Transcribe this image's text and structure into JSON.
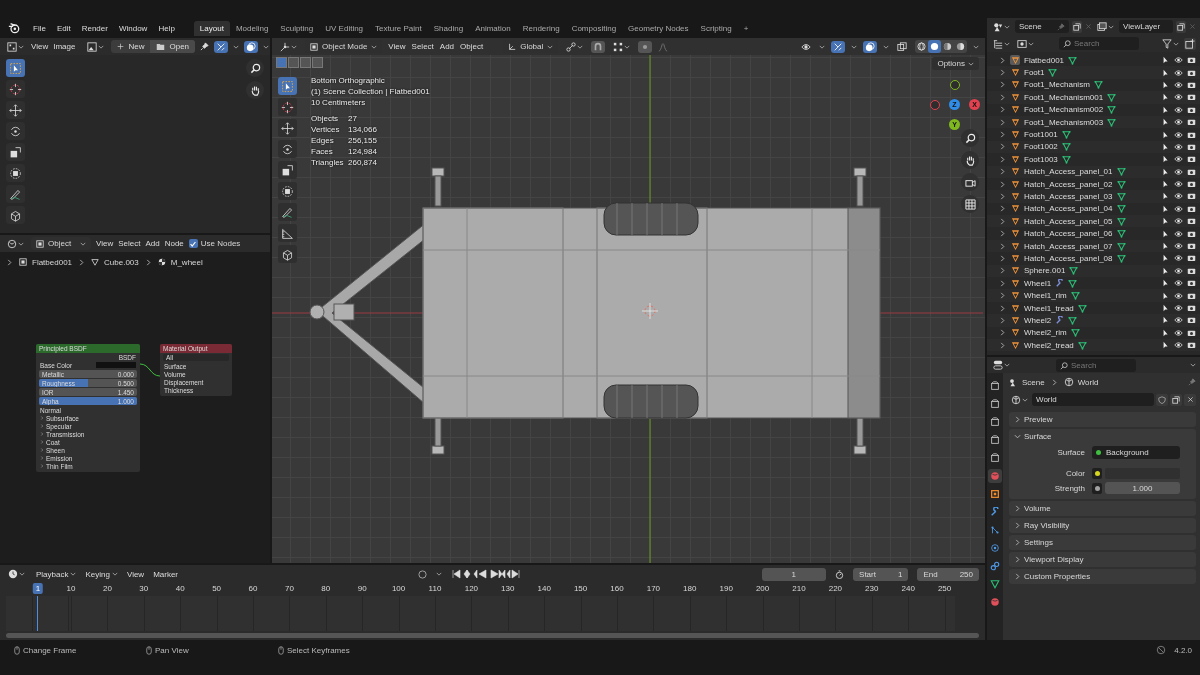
{
  "top_bar": {
    "menus": [
      "File",
      "Edit",
      "Render",
      "Window",
      "Help"
    ],
    "workspaces": [
      {
        "label": "Layout",
        "selected": true
      },
      {
        "label": "Modeling",
        "selected": false
      },
      {
        "label": "Sculpting",
        "selected": false
      },
      {
        "label": "UV Editing",
        "selected": false
      },
      {
        "label": "Texture Paint",
        "selected": false
      },
      {
        "label": "Shading",
        "selected": false
      },
      {
        "label": "Animation",
        "selected": false
      },
      {
        "label": "Rendering",
        "selected": false
      },
      {
        "label": "Compositing",
        "selected": false
      },
      {
        "label": "Geometry Nodes",
        "selected": false
      },
      {
        "label": "Scripting",
        "selected": false
      }
    ],
    "add_workspace": "+"
  },
  "image_editor": {
    "menus": [
      "View",
      "Image"
    ],
    "new_button": "New",
    "open_button": "Open",
    "tools": [
      {
        "kind": "select",
        "selected": true
      },
      {
        "kind": "cursor",
        "selected": false
      },
      {
        "kind": "move",
        "selected": false
      },
      {
        "kind": "rotate",
        "selected": false
      },
      {
        "kind": "scale",
        "selected": false
      },
      {
        "kind": "transform",
        "selected": false
      },
      {
        "kind": "annotate",
        "selected": false
      },
      {
        "kind": "add_cube",
        "selected": false
      }
    ]
  },
  "node_editor": {
    "mode": "Object",
    "menus": [
      "View",
      "Select",
      "Add",
      "Node"
    ],
    "use_nodes": {
      "label": "Use Nodes",
      "checked": true
    },
    "breadcrumbs": [
      {
        "kind": "object",
        "label": "Flatbed001"
      },
      {
        "kind": "mesh",
        "label": "Cube.003"
      },
      {
        "kind": "material",
        "label": "M_wheel"
      }
    ],
    "nodes": [
      {
        "kind": "shader",
        "title": "Principled BSDF",
        "output": "BSDF",
        "rows": [
          {
            "kind": "color",
            "label": "Base Color"
          },
          {
            "kind": "slider",
            "label": "Metallic",
            "value": "0.000",
            "level": 0
          },
          {
            "kind": "slider",
            "label": "Roughness",
            "value": "0.500",
            "level": 0.5
          },
          {
            "kind": "slider",
            "label": "IOR",
            "value": "1.450",
            "level": 0
          },
          {
            "kind": "slider",
            "label": "Alpha",
            "value": "1.000",
            "level": 1
          },
          {
            "kind": "socket",
            "label": "Normal"
          },
          {
            "kind": "group",
            "label": "Subsurface"
          },
          {
            "kind": "group",
            "label": "Specular"
          },
          {
            "kind": "group",
            "label": "Transmission"
          },
          {
            "kind": "group",
            "label": "Coat"
          },
          {
            "kind": "group",
            "label": "Sheen"
          },
          {
            "kind": "group",
            "label": "Emission"
          },
          {
            "kind": "group",
            "label": "Thin Film"
          }
        ]
      },
      {
        "kind": "output",
        "title": "Material Output",
        "target": "All",
        "rows": [
          {
            "kind": "socket",
            "label": "Surface"
          },
          {
            "kind": "socket",
            "label": "Volume"
          },
          {
            "kind": "socket",
            "label": "Displacement"
          },
          {
            "kind": "socket",
            "label": "Thickness"
          }
        ]
      }
    ]
  },
  "viewport": {
    "mode": "Object Mode",
    "menus": [
      "View",
      "Select",
      "Add",
      "Object"
    ],
    "orientation": "Global",
    "options": "Options",
    "toggles": [
      {
        "kind": "visibility",
        "on": false
      },
      {
        "kind": "gizmo",
        "on": true
      },
      {
        "kind": "overlay",
        "on": true
      },
      {
        "kind": "xray",
        "on": false
      }
    ],
    "shading": [
      {
        "kind": "wireframe",
        "selected": false
      },
      {
        "kind": "solid",
        "selected": true
      },
      {
        "kind": "material",
        "selected": false
      },
      {
        "kind": "rendered",
        "selected": false
      }
    ],
    "info": [
      "Bottom Orthographic",
      "(1) Scene Collection | Flatbed001",
      "10 Centimeters"
    ],
    "stats": [
      {
        "label": "Objects",
        "value": "27"
      },
      {
        "label": "Vertices",
        "value": "134,066"
      },
      {
        "label": "Edges",
        "value": "256,155"
      },
      {
        "label": "Faces",
        "value": "124,984"
      },
      {
        "label": "Triangles",
        "value": "260,874"
      }
    ],
    "tools": [
      {
        "kind": "select",
        "selected": true
      },
      {
        "kind": "cursor",
        "selected": false
      },
      {
        "kind": "move",
        "selected": false
      },
      {
        "kind": "rotate",
        "selected": false
      },
      {
        "kind": "scale",
        "selected": false
      },
      {
        "kind": "transform",
        "selected": false
      },
      {
        "kind": "annotate",
        "selected": false
      },
      {
        "kind": "measure",
        "selected": false
      },
      {
        "kind": "add_cube",
        "selected": false
      }
    ],
    "gizmo": [
      {
        "label": "Z",
        "color": "#2f8de8"
      },
      {
        "label": "X",
        "color": "#e2414f"
      },
      {
        "label": "Y",
        "color": "#7fb81e"
      }
    ]
  },
  "timeline": {
    "menus": [
      "Playback",
      "Keying",
      "View",
      "Marker"
    ],
    "current_frame": "1",
    "start_label": "Start",
    "start": "1",
    "end_label": "End",
    "end": "250",
    "ticks": [
      "1",
      "10",
      "20",
      "30",
      "40",
      "50",
      "60",
      "70",
      "80",
      "90",
      "100",
      "110",
      "120",
      "130",
      "140",
      "150",
      "160",
      "170",
      "180",
      "190",
      "200",
      "210",
      "220",
      "230",
      "240",
      "250"
    ]
  },
  "outliner": {
    "scene": "Scene",
    "view_layer": "ViewLayer",
    "search_placeholder": "Search",
    "items": [
      {
        "name": "Flatbed001",
        "active": true,
        "modifier": false
      },
      {
        "name": "Foot1",
        "active": false,
        "modifier": false
      },
      {
        "name": "Foot1_Mechanism",
        "active": false,
        "modifier": false
      },
      {
        "name": "Foot1_Mechanism001",
        "active": false,
        "modifier": false
      },
      {
        "name": "Foot1_Mechanism002",
        "active": false,
        "modifier": false
      },
      {
        "name": "Foot1_Mechanism003",
        "active": false,
        "modifier": false
      },
      {
        "name": "Foot1001",
        "active": false,
        "modifier": false
      },
      {
        "name": "Foot1002",
        "active": false,
        "modifier": false
      },
      {
        "name": "Foot1003",
        "active": false,
        "modifier": false
      },
      {
        "name": "Hatch_Access_panel_01",
        "active": false,
        "modifier": false
      },
      {
        "name": "Hatch_Access_panel_02",
        "active": false,
        "modifier": false
      },
      {
        "name": "Hatch_Access_panel_03",
        "active": false,
        "modifier": false
      },
      {
        "name": "Hatch_Access_panel_04",
        "active": false,
        "modifier": false
      },
      {
        "name": "Hatch_Access_panel_05",
        "active": false,
        "modifier": false
      },
      {
        "name": "Hatch_Access_panel_06",
        "active": false,
        "modifier": false
      },
      {
        "name": "Hatch_Access_panel_07",
        "active": false,
        "modifier": false
      },
      {
        "name": "Hatch_Access_panel_08",
        "active": false,
        "modifier": false
      },
      {
        "name": "Sphere.001",
        "active": false,
        "modifier": false
      },
      {
        "name": "Wheel1",
        "active": false,
        "modifier": true
      },
      {
        "name": "Wheel1_rim",
        "active": false,
        "modifier": false
      },
      {
        "name": "Wheel1_tread",
        "active": false,
        "modifier": false
      },
      {
        "name": "Wheel2",
        "active": false,
        "modifier": true
      },
      {
        "name": "Wheel2_rim",
        "active": false,
        "modifier": false
      },
      {
        "name": "Wheel2_tread",
        "active": false,
        "modifier": false
      }
    ]
  },
  "properties": {
    "search_placeholder": "Search",
    "tabs": [
      {
        "kind": "tool",
        "selected": false
      },
      {
        "kind": "render",
        "selected": false
      },
      {
        "kind": "output",
        "selected": false
      },
      {
        "kind": "view_layer",
        "selected": false
      },
      {
        "kind": "scene",
        "selected": false
      },
      {
        "kind": "world",
        "selected": true
      },
      {
        "kind": "object",
        "selected": false
      },
      {
        "kind": "modifiers",
        "selected": false
      },
      {
        "kind": "particles",
        "selected": false
      },
      {
        "kind": "physics",
        "selected": false
      },
      {
        "kind": "constraints",
        "selected": false
      },
      {
        "kind": "data",
        "selected": false
      },
      {
        "kind": "material",
        "selected": false
      }
    ],
    "breadcrumbs": [
      "Scene",
      "World"
    ],
    "datablock": "World",
    "panels": [
      {
        "label": "Preview",
        "expanded": false
      },
      {
        "label": "Surface",
        "expanded": true,
        "fields": [
          {
            "kind": "shader",
            "label": "Surface",
            "value": "Background",
            "color": "#3fbf3f"
          },
          {
            "kind": "color",
            "label": "Color",
            "color": "#d6d61e"
          },
          {
            "kind": "number",
            "label": "Strength",
            "value": "1.000",
            "color": "#a1a1a1"
          }
        ]
      },
      {
        "label": "Volume",
        "expanded": false
      },
      {
        "label": "Ray Visibility",
        "expanded": false
      },
      {
        "label": "Settings",
        "expanded": false
      },
      {
        "label": "Viewport Display",
        "expanded": false
      },
      {
        "label": "Custom Properties",
        "expanded": false
      }
    ]
  },
  "status_bar": {
    "hints": [
      "Change Frame",
      "Pan View",
      "Select Keyframes"
    ],
    "version": "4.2.0"
  }
}
